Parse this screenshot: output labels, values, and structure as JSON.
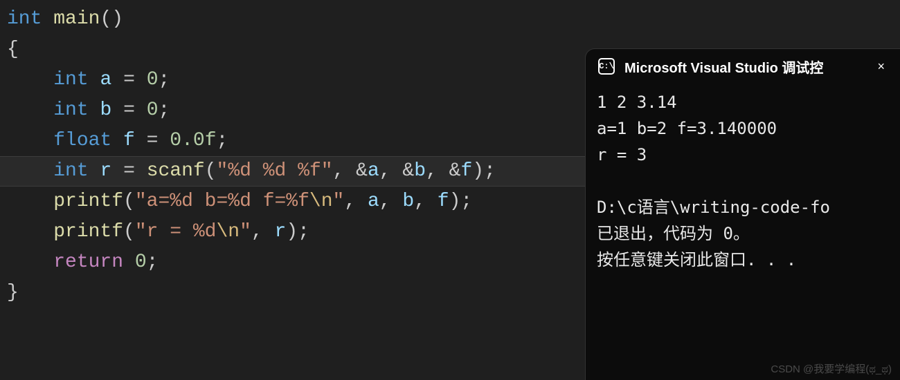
{
  "editor": {
    "lines": [
      {
        "indent": 0,
        "tokens": [
          {
            "t": "int",
            "c": "kw"
          },
          {
            "t": " ",
            "c": ""
          },
          {
            "t": "main",
            "c": "fn"
          },
          {
            "t": "()",
            "c": "punct"
          }
        ]
      },
      {
        "indent": 0,
        "tokens": [
          {
            "t": "{",
            "c": "brace"
          }
        ]
      },
      {
        "indent": 1,
        "tokens": [
          {
            "t": "int",
            "c": "kw"
          },
          {
            "t": " a ",
            "c": "var"
          },
          {
            "t": "=",
            "c": "punct"
          },
          {
            "t": " ",
            "c": ""
          },
          {
            "t": "0",
            "c": "num"
          },
          {
            "t": ";",
            "c": "punct"
          }
        ]
      },
      {
        "indent": 1,
        "tokens": [
          {
            "t": "int",
            "c": "kw"
          },
          {
            "t": " b ",
            "c": "var"
          },
          {
            "t": "=",
            "c": "punct"
          },
          {
            "t": " ",
            "c": ""
          },
          {
            "t": "0",
            "c": "num"
          },
          {
            "t": ";",
            "c": "punct"
          }
        ]
      },
      {
        "indent": 1,
        "tokens": [
          {
            "t": "float",
            "c": "kw"
          },
          {
            "t": " f ",
            "c": "var"
          },
          {
            "t": "=",
            "c": "punct"
          },
          {
            "t": " ",
            "c": ""
          },
          {
            "t": "0.0f",
            "c": "num"
          },
          {
            "t": ";",
            "c": "punct"
          }
        ]
      },
      {
        "indent": 1,
        "hl": true,
        "tokens": [
          {
            "t": "int",
            "c": "kw"
          },
          {
            "t": " r ",
            "c": "var"
          },
          {
            "t": "=",
            "c": "punct"
          },
          {
            "t": " ",
            "c": ""
          },
          {
            "t": "scanf",
            "c": "fn"
          },
          {
            "t": "(",
            "c": "punct"
          },
          {
            "t": "\"%d %d %f\"",
            "c": "str"
          },
          {
            "t": ", ",
            "c": "punct"
          },
          {
            "t": "&",
            "c": "punct"
          },
          {
            "t": "a",
            "c": "var"
          },
          {
            "t": ", ",
            "c": "punct"
          },
          {
            "t": "&",
            "c": "punct"
          },
          {
            "t": "b",
            "c": "var"
          },
          {
            "t": ", ",
            "c": "punct"
          },
          {
            "t": "&",
            "c": "punct"
          },
          {
            "t": "f",
            "c": "var"
          },
          {
            "t": ")",
            "c": "punct"
          },
          {
            "t": ";",
            "c": "punct"
          }
        ]
      },
      {
        "indent": 1,
        "tokens": [
          {
            "t": "printf",
            "c": "fn"
          },
          {
            "t": "(",
            "c": "punct"
          },
          {
            "t": "\"a=%d b=%d f=%f",
            "c": "str"
          },
          {
            "t": "\\n",
            "c": "esc"
          },
          {
            "t": "\"",
            "c": "str"
          },
          {
            "t": ", ",
            "c": "punct"
          },
          {
            "t": "a",
            "c": "var"
          },
          {
            "t": ", ",
            "c": "punct"
          },
          {
            "t": "b",
            "c": "var"
          },
          {
            "t": ", ",
            "c": "punct"
          },
          {
            "t": "f",
            "c": "var"
          },
          {
            "t": ")",
            "c": "punct"
          },
          {
            "t": ";",
            "c": "punct"
          }
        ]
      },
      {
        "indent": 1,
        "tokens": [
          {
            "t": "printf",
            "c": "fn"
          },
          {
            "t": "(",
            "c": "punct"
          },
          {
            "t": "\"r = %d",
            "c": "str"
          },
          {
            "t": "\\n",
            "c": "esc"
          },
          {
            "t": "\"",
            "c": "str"
          },
          {
            "t": ", ",
            "c": "punct"
          },
          {
            "t": "r",
            "c": "var"
          },
          {
            "t": ")",
            "c": "punct"
          },
          {
            "t": ";",
            "c": "punct"
          }
        ]
      },
      {
        "indent": 1,
        "tokens": [
          {
            "t": "return",
            "c": "paren"
          },
          {
            "t": " ",
            "c": ""
          },
          {
            "t": "0",
            "c": "num"
          },
          {
            "t": ";",
            "c": "punct"
          }
        ]
      },
      {
        "indent": 0,
        "tokens": [
          {
            "t": "}",
            "c": "brace"
          }
        ]
      }
    ],
    "indent_unit": "    "
  },
  "console": {
    "icon_text": "C:\\",
    "title": "Microsoft Visual Studio 调试控",
    "close": "×",
    "output": "1 2 3.14\na=1 b=2 f=3.140000\nr = 3\n\nD:\\c语言\\writing-code-fo\n已退出，代码为 0。\n按任意键关闭此窗口. . ."
  },
  "watermark": "CSDN @我要学编程(ಥ_ಥ)"
}
